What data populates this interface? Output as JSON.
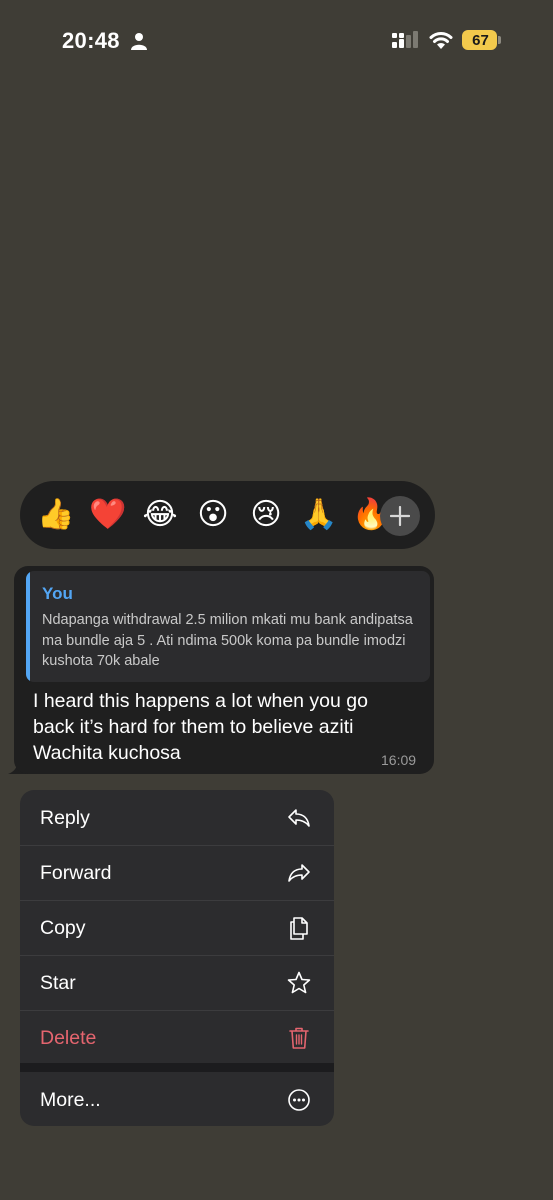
{
  "status_bar": {
    "time": "20:48",
    "battery_level": "67",
    "icons": [
      "person-icon",
      "signal-icon",
      "wifi-icon",
      "battery-icon"
    ]
  },
  "reactions": {
    "emojis": [
      "👍",
      "❤️",
      "😂",
      "😮",
      "😢",
      "🙏",
      "🔥"
    ],
    "more_icon": "plus-icon"
  },
  "message": {
    "quote": {
      "author": "You",
      "text": "Ndapanga withdrawal 2.5 milion mkati mu bank andipatsa ma bundle aja 5 . Ati ndima 500k  koma pa bundle imodzi kushota 70k abale"
    },
    "text": "I heard this happens a lot when you go back it’s hard for them to believe aziti Wachita kuchosa",
    "time": "16:09"
  },
  "menu": {
    "items": [
      {
        "label": "Reply",
        "icon": "reply-icon"
      },
      {
        "label": "Forward",
        "icon": "forward-icon"
      },
      {
        "label": "Copy",
        "icon": "copy-icon"
      },
      {
        "label": "Star",
        "icon": "star-icon"
      },
      {
        "label": "Delete",
        "icon": "trash-icon",
        "danger": true
      },
      {
        "label": "More...",
        "icon": "more-icon"
      }
    ]
  },
  "colors": {
    "background": "#3f3d36",
    "bubble": "#1f1f1f",
    "accent": "#53a6f4",
    "danger": "#e5656f",
    "battery": "#f2c94c"
  }
}
